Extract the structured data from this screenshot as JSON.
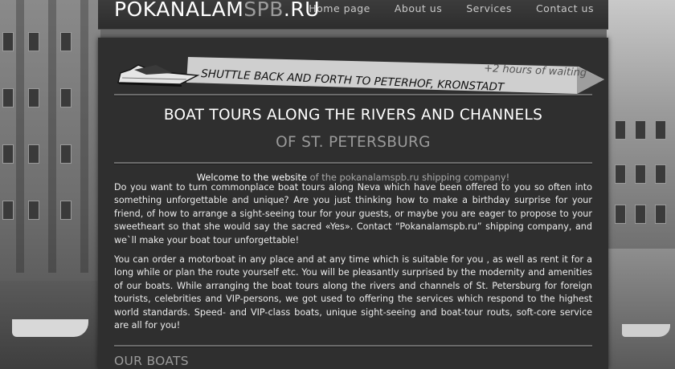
{
  "header": {
    "logo_main": "POKANALAM",
    "logo_accent": "SPB",
    "logo_suffix": ".RU",
    "nav": [
      "Home page",
      "About us",
      "Services",
      "Contact us"
    ]
  },
  "banner": {
    "text": "SHUTTLE BACK AND FORTH TO PETERHOF, KRONSTADT",
    "extra": "+2 hours of waiting"
  },
  "main": {
    "title_line1": "BOAT TOURS ALONG THE RIVERS AND CHANNELS",
    "title_line2": "OF ST. PETERSBURG",
    "welcome_prefix": "Welcome to the website",
    "welcome_suffix": "of the pokanalamspb.ru shipping company!",
    "paragraph1": "Do you want to turn commonplace boat tours along Neva which have been offered to you so often into something unforgettable and unique? Are you just thinking how to make a birthday surprise for your friend, of how to arrange a sight-seeing tour for your guests, or maybe you are eager to propose to your sweetheart so that she would say the sacred «Yes». Contact “Pokanalamspb.ru” shipping company, and we`ll make your boat tour unforgettable!",
    "paragraph2": "You can order a motorboat in any place and at any time which is suitable for you , as well as rent it for a long while or plan the route yourself etc. You will be pleasantly surprised by the modernity and amenities of our boats. While arranging the boat tours along the rivers and channels of St. Petersburg for foreign tourists, celebrities and VIP-persons, we got used to offering the services which respond to the highest world standards. Speed- and VIP-class boats, unique sight-seeing and boat-tour routs, soft-core service are all for you!",
    "section_heading": "OUR BOATS"
  }
}
